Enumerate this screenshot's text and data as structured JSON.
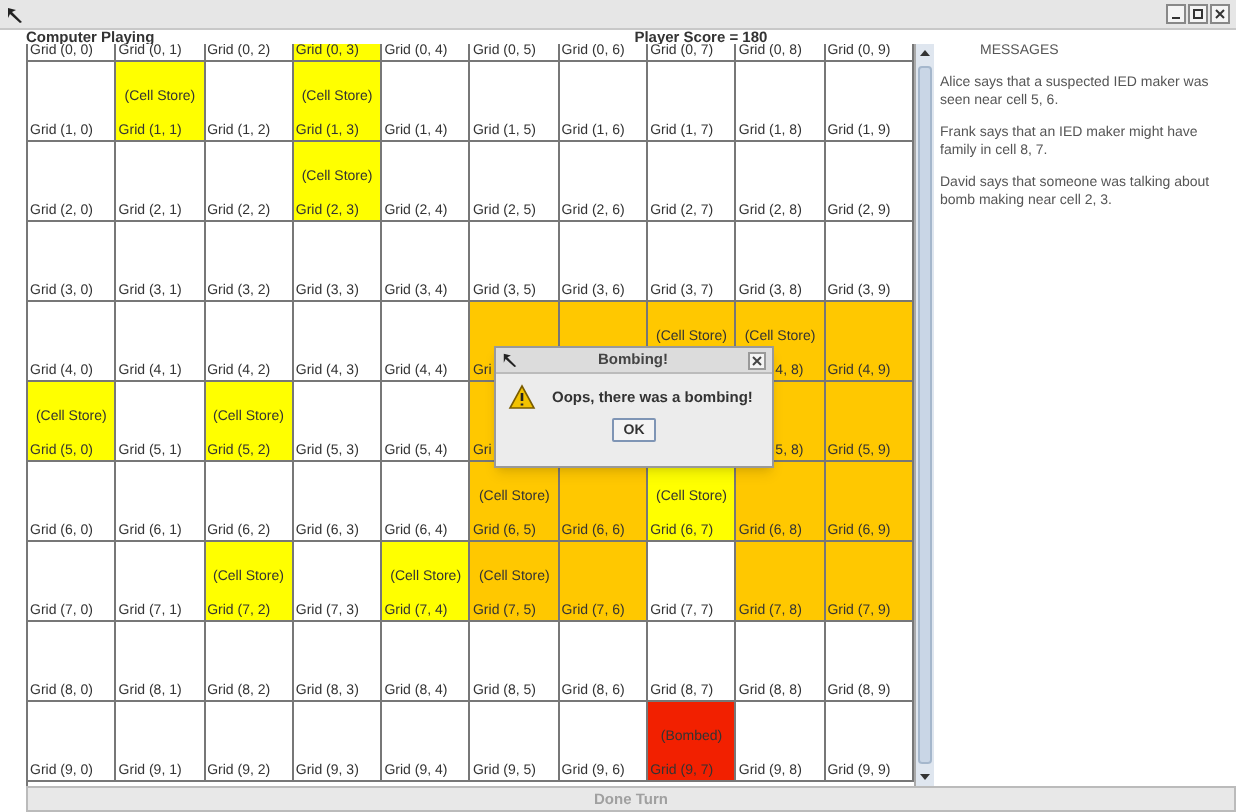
{
  "header": {
    "left": "Computer Playing",
    "score": "Player Score = 180"
  },
  "grid": [
    {
      "cells": [
        {
          "label": "Grid (0, 0)",
          "color": "#ffffff"
        },
        {
          "label": "Grid (0, 1)",
          "color": "#ffffff"
        },
        {
          "label": "Grid (0, 2)",
          "color": "#ffffff"
        },
        {
          "label": "Grid (0, 3)",
          "color": "#ffff00"
        },
        {
          "label": "Grid (0, 4)",
          "color": "#ffffff"
        },
        {
          "label": "Grid (0, 5)",
          "color": "#ffffff"
        },
        {
          "label": "Grid (0, 6)",
          "color": "#ffffff"
        },
        {
          "label": "Grid (0, 7)",
          "color": "#ffffff"
        },
        {
          "label": "Grid (0, 8)",
          "color": "#ffffff"
        },
        {
          "label": "Grid (0, 9)",
          "color": "#ffffff"
        }
      ]
    },
    {
      "cells": [
        {
          "label": "Grid (1, 0)",
          "color": "#ffffff"
        },
        {
          "label": "Grid (1, 1)",
          "color": "#ffff00",
          "note": "(Cell Store)"
        },
        {
          "label": "Grid (1, 2)",
          "color": "#ffffff"
        },
        {
          "label": "Grid (1, 3)",
          "color": "#ffff00",
          "note": "(Cell Store)"
        },
        {
          "label": "Grid (1, 4)",
          "color": "#ffffff"
        },
        {
          "label": "Grid (1, 5)",
          "color": "#ffffff"
        },
        {
          "label": "Grid (1, 6)",
          "color": "#ffffff"
        },
        {
          "label": "Grid (1, 7)",
          "color": "#ffffff"
        },
        {
          "label": "Grid (1, 8)",
          "color": "#ffffff"
        },
        {
          "label": "Grid (1, 9)",
          "color": "#ffffff"
        }
      ]
    },
    {
      "cells": [
        {
          "label": "Grid (2, 0)",
          "color": "#ffffff"
        },
        {
          "label": "Grid (2, 1)",
          "color": "#ffffff"
        },
        {
          "label": "Grid (2, 2)",
          "color": "#ffffff"
        },
        {
          "label": "Grid (2, 3)",
          "color": "#ffff00",
          "note": "(Cell Store)"
        },
        {
          "label": "Grid (2, 4)",
          "color": "#ffffff"
        },
        {
          "label": "Grid (2, 5)",
          "color": "#ffffff"
        },
        {
          "label": "Grid (2, 6)",
          "color": "#ffffff"
        },
        {
          "label": "Grid (2, 7)",
          "color": "#ffffff"
        },
        {
          "label": "Grid (2, 8)",
          "color": "#ffffff"
        },
        {
          "label": "Grid (2, 9)",
          "color": "#ffffff"
        }
      ]
    },
    {
      "cells": [
        {
          "label": "Grid (3, 0)",
          "color": "#ffffff"
        },
        {
          "label": "Grid (3, 1)",
          "color": "#ffffff"
        },
        {
          "label": "Grid (3, 2)",
          "color": "#ffffff"
        },
        {
          "label": "Grid (3, 3)",
          "color": "#ffffff"
        },
        {
          "label": "Grid (3, 4)",
          "color": "#ffffff"
        },
        {
          "label": "Grid (3, 5)",
          "color": "#ffffff"
        },
        {
          "label": "Grid (3, 6)",
          "color": "#ffffff"
        },
        {
          "label": "Grid (3, 7)",
          "color": "#ffffff"
        },
        {
          "label": "Grid (3, 8)",
          "color": "#ffffff"
        },
        {
          "label": "Grid (3, 9)",
          "color": "#ffffff"
        }
      ]
    },
    {
      "cells": [
        {
          "label": "Grid (4, 0)",
          "color": "#ffffff"
        },
        {
          "label": "Grid (4, 1)",
          "color": "#ffffff"
        },
        {
          "label": "Grid (4, 2)",
          "color": "#ffffff"
        },
        {
          "label": "Grid (4, 3)",
          "color": "#ffffff"
        },
        {
          "label": "Grid (4, 4)",
          "color": "#ffffff"
        },
        {
          "label": "Gri",
          "color": "#ffc800"
        },
        {
          "color": "#ffc800"
        },
        {
          "color": "#ffc800",
          "note": "(Cell Store)"
        },
        {
          "label": "4, 8)",
          "color": "#ffc800",
          "note": "(Cell Store)",
          "clipped_left": true
        },
        {
          "label": "Grid (4, 9)",
          "color": "#ffc800"
        }
      ]
    },
    {
      "cells": [
        {
          "label": "Grid (5, 0)",
          "color": "#ffff00",
          "note": "(Cell Store)"
        },
        {
          "label": "Grid (5, 1)",
          "color": "#ffffff"
        },
        {
          "label": "Grid (5, 2)",
          "color": "#ffff00",
          "note": "(Cell Store)"
        },
        {
          "label": "Grid (5, 3)",
          "color": "#ffffff"
        },
        {
          "label": "Grid (5, 4)",
          "color": "#ffffff"
        },
        {
          "label": "Gri",
          "color": "#ffc800"
        },
        {},
        {},
        {
          "label": "5, 8)",
          "color": "#ffc800",
          "clipped_left": true
        },
        {
          "label": "Grid (5, 9)",
          "color": "#ffc800"
        }
      ]
    },
    {
      "cells": [
        {
          "label": "Grid (6, 0)",
          "color": "#ffffff"
        },
        {
          "label": "Grid (6, 1)",
          "color": "#ffffff"
        },
        {
          "label": "Grid (6, 2)",
          "color": "#ffffff"
        },
        {
          "label": "Grid (6, 3)",
          "color": "#ffffff"
        },
        {
          "label": "Grid (6, 4)",
          "color": "#ffffff"
        },
        {
          "label": "Grid (6, 5)",
          "color": "#ffc800",
          "note": "(Cell Store)"
        },
        {
          "label": "Grid (6, 6)",
          "color": "#ffc800"
        },
        {
          "label": "Grid (6, 7)",
          "color": "#ffff00",
          "note": "(Cell Store)"
        },
        {
          "label": "Grid (6, 8)",
          "color": "#ffc800"
        },
        {
          "label": "Grid (6, 9)",
          "color": "#ffc800"
        }
      ]
    },
    {
      "cells": [
        {
          "label": "Grid (7, 0)",
          "color": "#ffffff"
        },
        {
          "label": "Grid (7, 1)",
          "color": "#ffffff"
        },
        {
          "label": "Grid (7, 2)",
          "color": "#ffff00",
          "note": "(Cell Store)"
        },
        {
          "label": "Grid (7, 3)",
          "color": "#ffffff"
        },
        {
          "label": "Grid (7, 4)",
          "color": "#ffff00",
          "note": "(Cell Store)"
        },
        {
          "label": "Grid (7, 5)",
          "color": "#ffc800",
          "note": "(Cell Store)"
        },
        {
          "label": "Grid (7, 6)",
          "color": "#ffc800"
        },
        {
          "label": "Grid (7, 7)",
          "color": "#ffffff"
        },
        {
          "label": "Grid (7, 8)",
          "color": "#ffc800"
        },
        {
          "label": "Grid (7, 9)",
          "color": "#ffc800"
        }
      ]
    },
    {
      "cells": [
        {
          "label": "Grid (8, 0)",
          "color": "#ffffff"
        },
        {
          "label": "Grid (8, 1)",
          "color": "#ffffff"
        },
        {
          "label": "Grid (8, 2)",
          "color": "#ffffff"
        },
        {
          "label": "Grid (8, 3)",
          "color": "#ffffff"
        },
        {
          "label": "Grid (8, 4)",
          "color": "#ffffff"
        },
        {
          "label": "Grid (8, 5)",
          "color": "#ffffff"
        },
        {
          "label": "Grid (8, 6)",
          "color": "#ffffff"
        },
        {
          "label": "Grid (8, 7)",
          "color": "#ffffff"
        },
        {
          "label": "Grid (8, 8)",
          "color": "#ffffff"
        },
        {
          "label": "Grid (8, 9)",
          "color": "#ffffff"
        }
      ]
    },
    {
      "cells": [
        {
          "label": "Grid (9, 0)",
          "color": "#ffffff"
        },
        {
          "label": "Grid (9, 1)",
          "color": "#ffffff"
        },
        {
          "label": "Grid (9, 2)",
          "color": "#ffffff"
        },
        {
          "label": "Grid (9, 3)",
          "color": "#ffffff"
        },
        {
          "label": "Grid (9, 4)",
          "color": "#ffffff"
        },
        {
          "label": "Grid (9, 5)",
          "color": "#ffffff"
        },
        {
          "label": "Grid (9, 6)",
          "color": "#ffffff"
        },
        {
          "label": "Grid (9, 7)",
          "color": "#f22000",
          "note": "(Bombed)"
        },
        {
          "label": "Grid (9, 8)",
          "color": "#ffffff"
        },
        {
          "label": "Grid (9, 9)",
          "color": "#ffffff"
        }
      ]
    }
  ],
  "messages": {
    "title": "MESSAGES",
    "items": [
      "Alice says that a suspected IED maker was seen near cell 5, 6.",
      "Frank says that an IED maker might have family in cell 8, 7.",
      "David says that someone was talking about bomb making near cell 2, 3."
    ]
  },
  "done_button": {
    "label": "Done Turn",
    "disabled": true
  },
  "dialog": {
    "title": "Bombing!",
    "message": "Oops, there was a bombing!",
    "button": "OK"
  }
}
